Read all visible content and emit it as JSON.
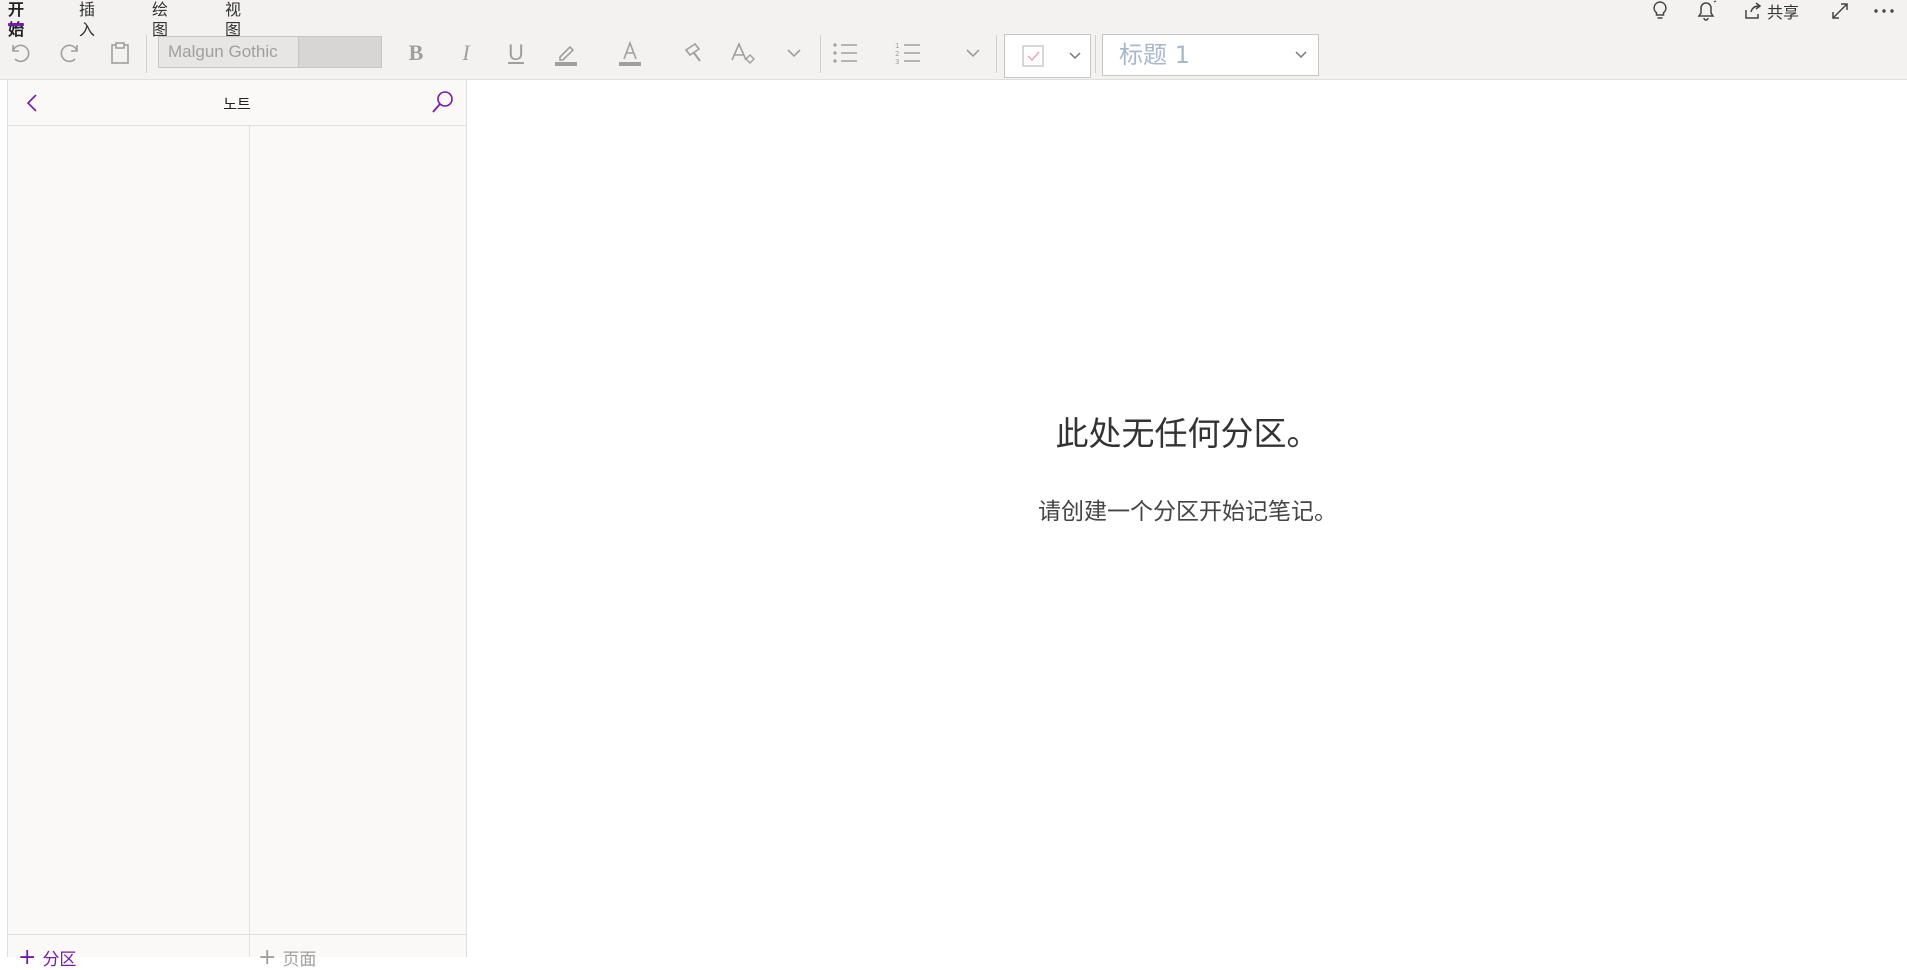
{
  "ribbon": {
    "tabs": [
      {
        "label": "开始",
        "active": true
      },
      {
        "label": "插入"
      },
      {
        "label": "绘图"
      },
      {
        "label": "视图"
      }
    ],
    "share_label": "共享",
    "font_name": "Malgun Gothic",
    "paragraph_style": "标题 1",
    "accent_color": "#7719aa"
  },
  "nav": {
    "title": "노트",
    "add_section_label": "分区",
    "add_page_label": "页面"
  },
  "main": {
    "empty_title": "此处无任何分区。",
    "empty_subtitle": "请创建一个分区开始记笔记。"
  }
}
